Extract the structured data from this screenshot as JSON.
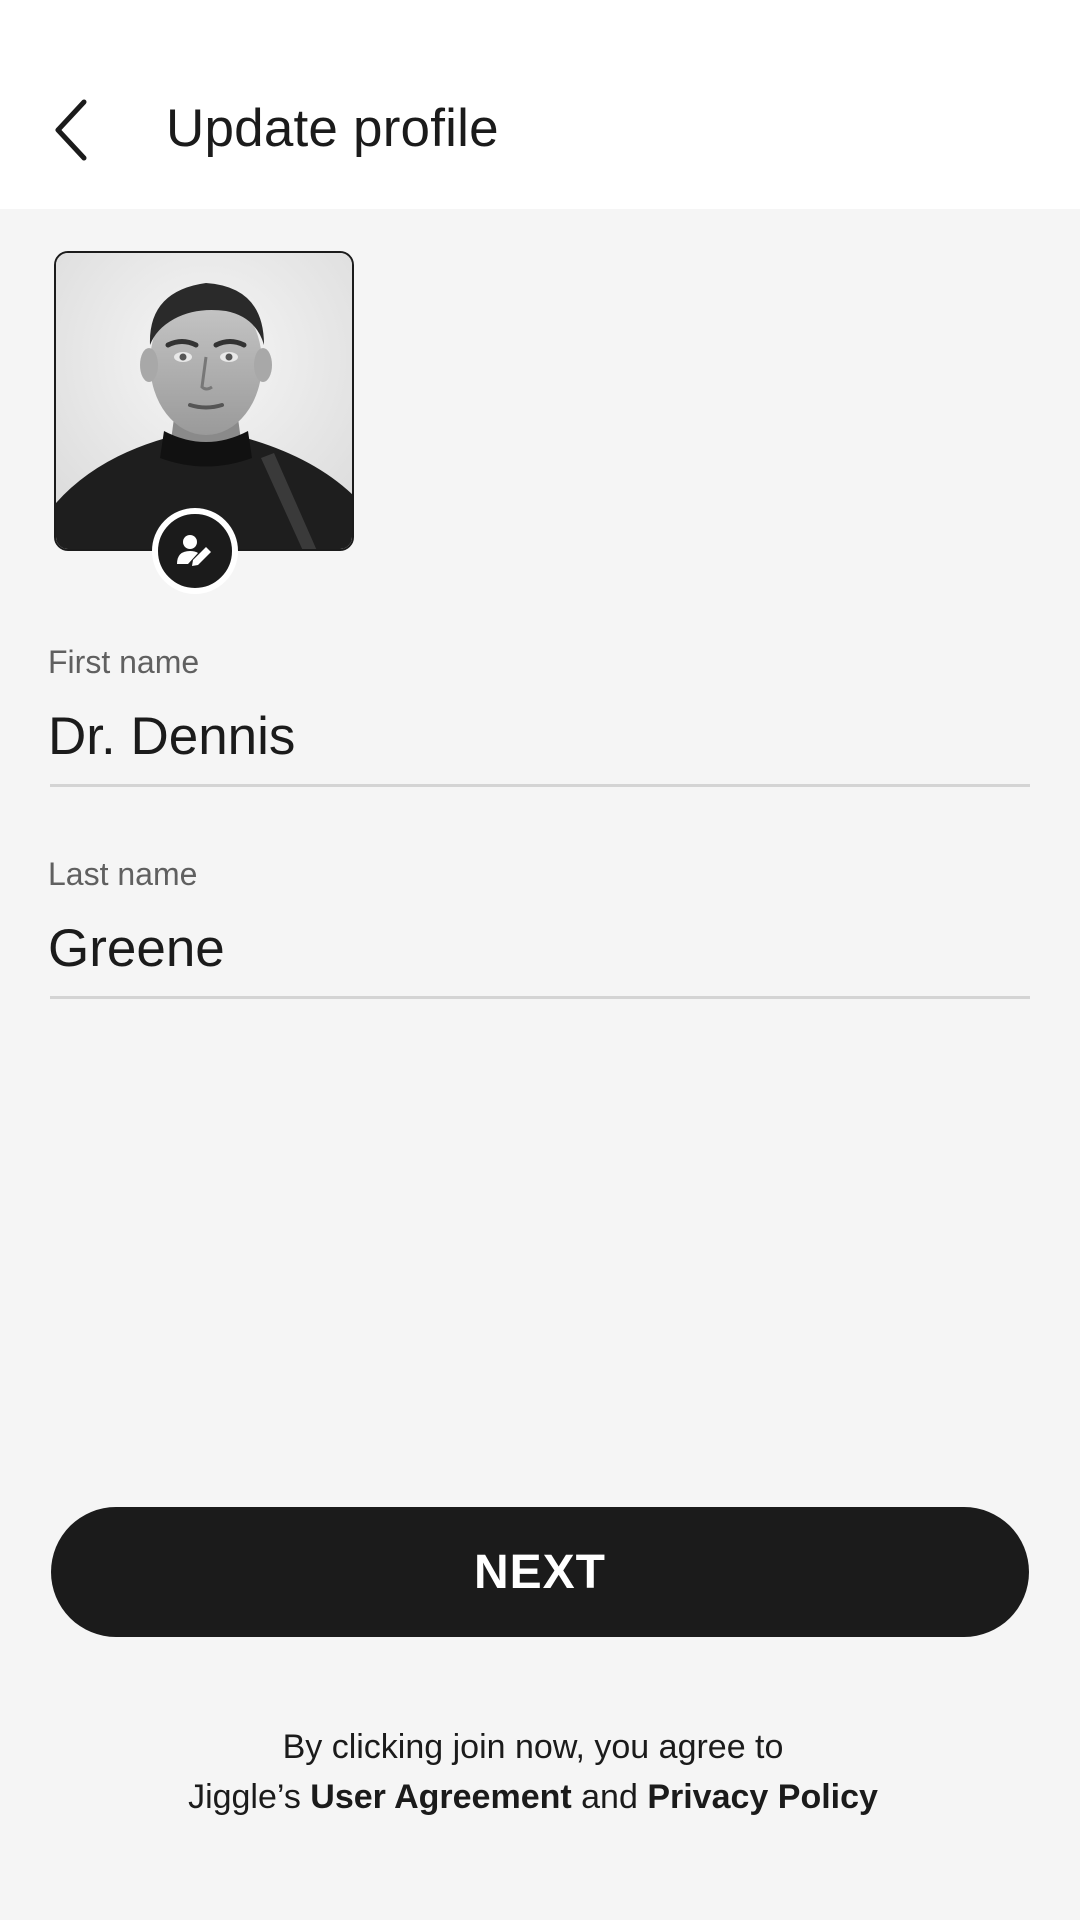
{
  "header": {
    "title": "Update profile",
    "back_icon": "chevron-left-icon"
  },
  "profile": {
    "avatar_alt": "Profile photo",
    "edit_icon": "user-edit-icon"
  },
  "form": {
    "first_name_label": "First name",
    "first_name_value": "Dr. Dennis",
    "last_name_label": "Last name",
    "last_name_value": "Greene"
  },
  "actions": {
    "next_label": "NEXT"
  },
  "legal": {
    "line1": "By clicking join now, you agree to",
    "prefix": "Jiggle’s ",
    "user_agreement": "User Agreement",
    "and": " and ",
    "privacy_policy": "Privacy Policy"
  },
  "colors": {
    "primary": "#1b1b1b",
    "background": "#f5f5f5",
    "header": "#ffffff",
    "label": "#606060",
    "divider": "#d4d4d4"
  }
}
